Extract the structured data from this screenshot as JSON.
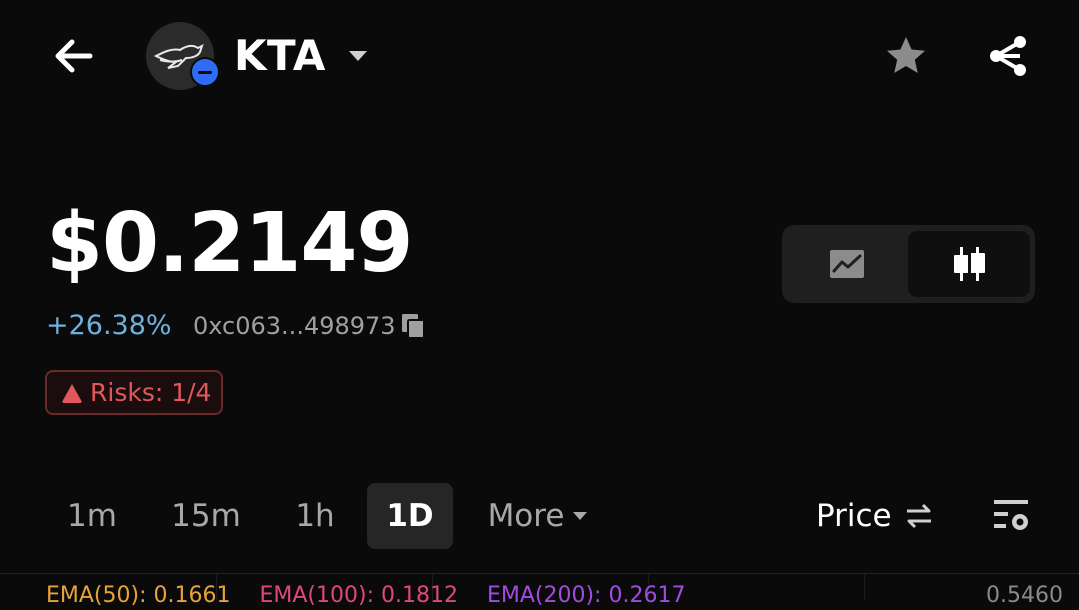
{
  "header": {
    "token_symbol": "KTA",
    "icons": [
      "back-arrow-icon",
      "kangaroo-logo-icon",
      "chain-badge-icon",
      "caret-down-icon",
      "star-icon",
      "share-icon"
    ]
  },
  "price": {
    "value": "$0.2149",
    "change": "+26.38%",
    "contract": "0xc063...498973",
    "copy_icon": "copy-icon"
  },
  "risk": {
    "label": "Risks: 1/4",
    "icon": "warning-triangle-icon"
  },
  "chart_type": {
    "options": [
      "line-chart-icon",
      "candlestick-icon"
    ],
    "selected": "candlestick-icon"
  },
  "timeframes": {
    "items": [
      "1m",
      "15m",
      "1h",
      "1D"
    ],
    "selected": "1D",
    "more_label": "More"
  },
  "price_toggle": {
    "label": "Price",
    "icon": "swap-icon"
  },
  "indicators": {
    "ema50": "EMA(50): 0.1661",
    "ema100": "EMA(100): 0.1812",
    "ema200": "EMA(200): 0.2617",
    "axis_label": "0.5460"
  },
  "colors": {
    "background": "#0a0a0a",
    "positive": "#6eb2dc",
    "risk": "#e0585d",
    "chain_badge": "#2f6cf5",
    "ema50": "#e8a23a",
    "ema100": "#e0477a",
    "ema200": "#a24be0"
  }
}
